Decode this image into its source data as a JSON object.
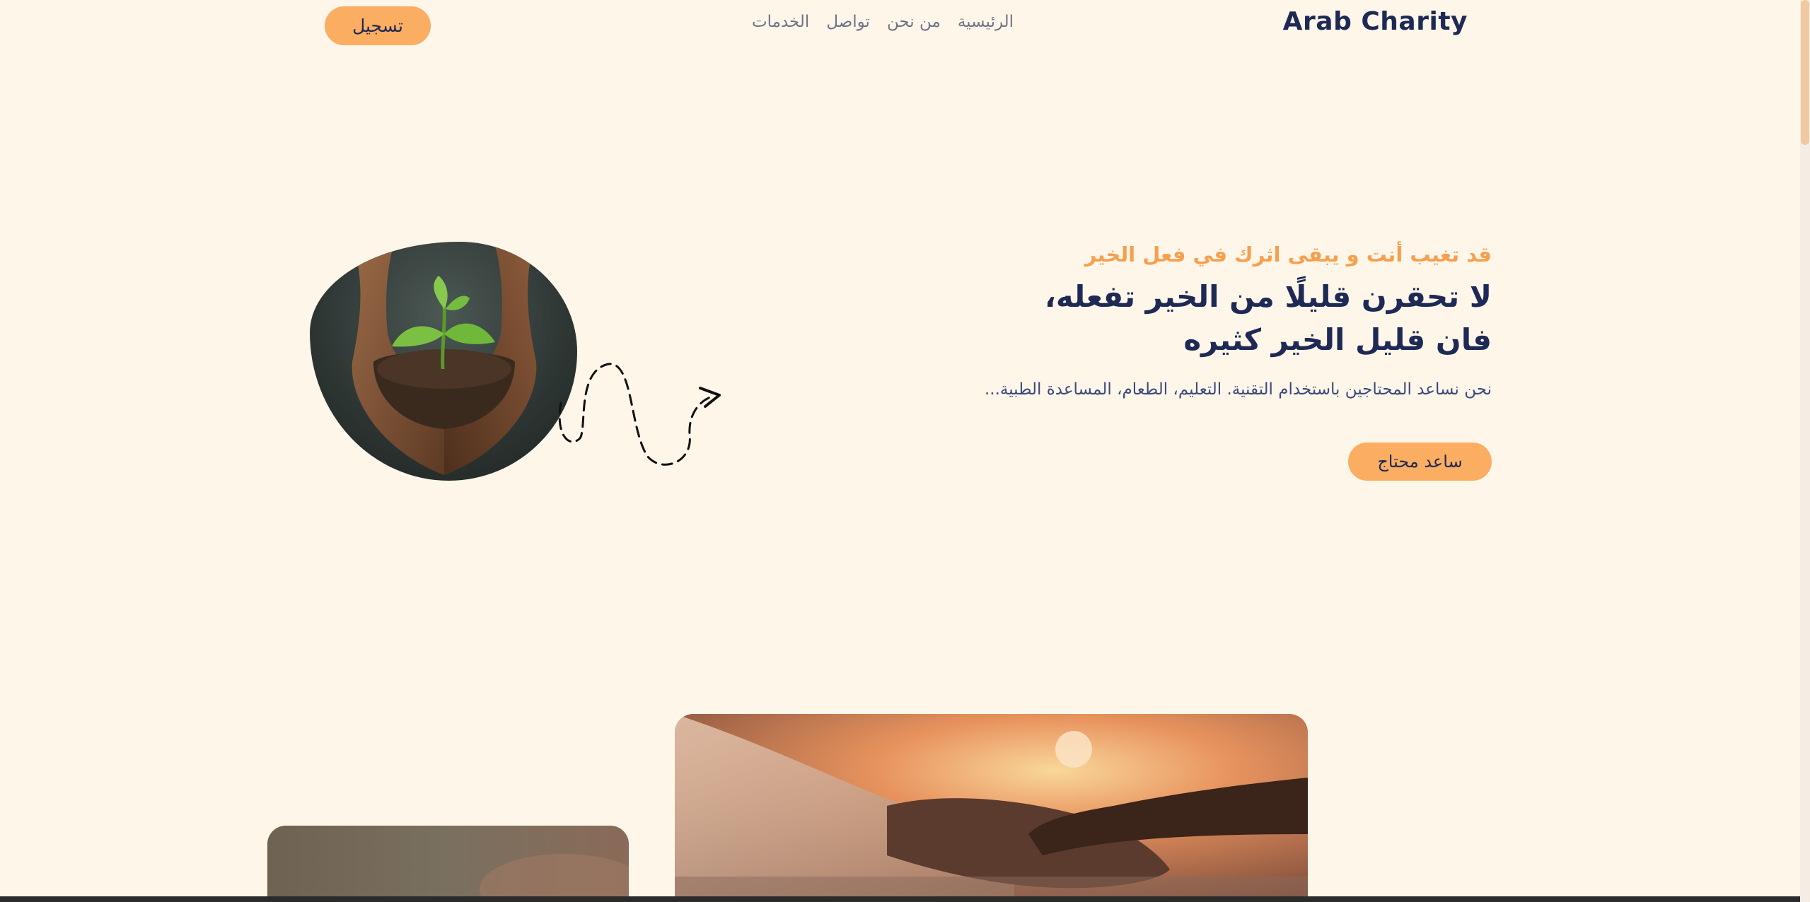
{
  "header": {
    "brand": "Arab Charity",
    "nav": [
      "الرئيسية",
      "من نحن",
      "تواصل",
      "الخدمات"
    ],
    "signup_label": "تسجيل"
  },
  "hero": {
    "tagline": "قد تغيب أنت و يبقى اثرك في فعل الخير",
    "title": "لا تحقرن قليلًا من الخير تفعله، فان قليل الخير كثيره",
    "description": "نحن نساعد المحتاجين باستخدام التقنية. التعليم، الطعام، المساعدة الطبية...",
    "cta_label": "ساعد محتاج"
  },
  "colors": {
    "background": "#fff6ea",
    "accent": "#fbad61",
    "primary_text": "#1e2a55"
  }
}
